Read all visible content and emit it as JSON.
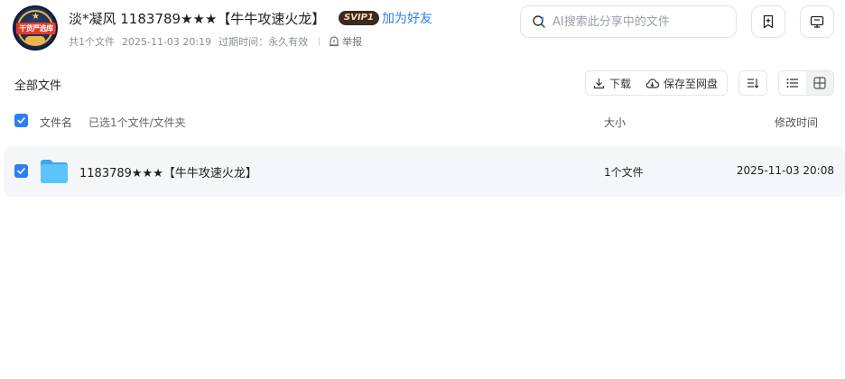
{
  "header": {
    "avatar_text": "干货严选库",
    "share_title": "淡*凝风 1183789★★★【牛牛攻速火龙】",
    "vip_badge": "SVIP1",
    "add_friend": "加为好友",
    "meta": {
      "file_count": "共1个文件",
      "share_time": "2025-11-03 20:19",
      "expiry": "过期时间：永久有效",
      "report": "举报"
    },
    "search": {
      "placeholder": "AI搜索此分享中的文件"
    }
  },
  "toolbar": {
    "all_files": "全部文件",
    "download_label": "下载",
    "save_label": "保存至网盘"
  },
  "table": {
    "columns": {
      "name": "文件名",
      "selected": "已选1个文件/文件夹",
      "size": "大小",
      "mtime": "修改时间"
    },
    "rows": [
      {
        "name": "1183789★★★【牛牛攻速火龙】",
        "size": "1个文件",
        "mtime": "2025-11-03 20:08",
        "type": "folder",
        "checked": true
      }
    ]
  },
  "colors": {
    "accent": "#2a7ff6",
    "folder": "#4fb8f5",
    "row_bg": "#f5f6f9"
  }
}
